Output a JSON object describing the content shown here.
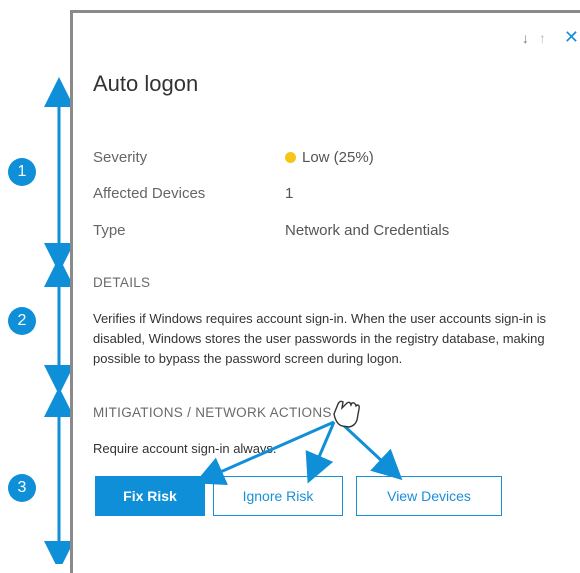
{
  "annotations": {
    "badges": [
      "1",
      "2",
      "3"
    ]
  },
  "panel": {
    "controls": {
      "down_arrow": "↓",
      "up_arrow": "↑",
      "close": "✕"
    },
    "title": "Auto logon",
    "properties": [
      {
        "label": "Severity",
        "value": "Low (25%)",
        "status_color": "#f5c518"
      },
      {
        "label": "Affected Devices",
        "value": "1"
      },
      {
        "label": "Type",
        "value": "Network and Credentials"
      }
    ],
    "details": {
      "heading": "DETAILS",
      "text": "Verifies if Windows requires account sign-in. When the user accounts sign-in is disabled, Windows stores the user passwords in the registry database, making possible to bypass the password screen during logon."
    },
    "mitigations": {
      "heading": "MITIGATIONS / NETWORK ACTIONS",
      "text": "Require account sign-in always.",
      "buttons": {
        "fix": "Fix Risk",
        "ignore": "Ignore Risk",
        "view": "View Devices"
      }
    }
  },
  "colors": {
    "accent": "#0f8fd8",
    "severity_low": "#f5c518"
  }
}
